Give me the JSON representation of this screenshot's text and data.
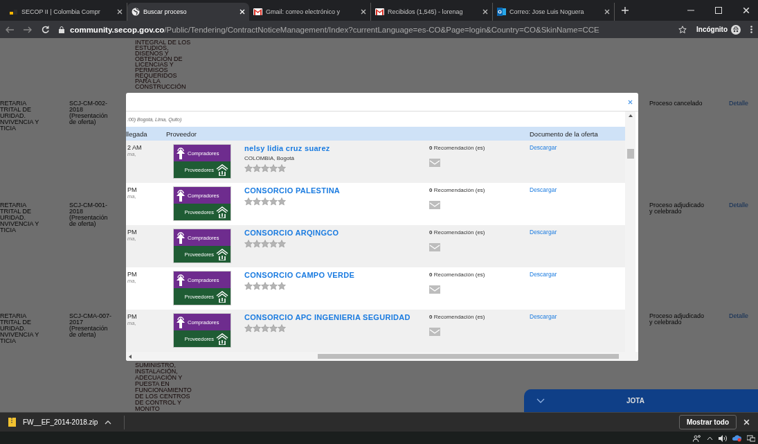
{
  "browser": {
    "tabs": [
      {
        "title": "SECOP II | Colombia Compr",
        "kind": "secop",
        "selected": false
      },
      {
        "title": "Buscar proceso",
        "kind": "globe",
        "selected": true
      },
      {
        "title": "Gmail: correo electrónico y",
        "kind": "gmail",
        "selected": false
      },
      {
        "title": "Recibidos (1,545) - lorenag",
        "kind": "gmail",
        "selected": false
      },
      {
        "title": "Correo: Jose Luis Noguera",
        "kind": "outlook",
        "selected": false
      }
    ],
    "address": {
      "host": "community.secop.gov.co",
      "path": "/Public/Tendering/ContractNoticeManagement/Index?currentLanguage=es-CO&Page=login&Country=CO&SkinName=CCE"
    },
    "incognito": "Incógnito"
  },
  "background_table": {
    "rows": [
      {
        "description": "INTEGRAL DE LOS\nESTUDIOS,\nDISEÑOS Y\nOBTENCIÓN DE\nLICENCIAS Y\nPERMISOS\nREQUERIDOS\nPARA LA\nCONSTRUCCIÓN"
      },
      {
        "entity": "RETARIA\nTRITAL DE\nURIDAD.\nNVIVENCIA Y\nTICIA",
        "code": "SCJ-CM-002-\n2018\n(Presentación\nde oferta)",
        "status": "Proceso cancelado",
        "link": "Detalle"
      },
      {
        "entity": "RETARIA\nTRITAL DE\nURIDAD.\nNVIVENCIA Y\nTICIA",
        "code": "SCJ-CM-001-\n2018\n(Presentación\nde oferta)",
        "status": "Proceso adjudicado\ny celebrado",
        "link": "Detalle"
      },
      {
        "entity": "RETARIA\nTRITAL DE\nURIDAD.\nNVIVENCIA Y\nTICIA",
        "code": "SCJ-CMA-007-\n2017\n(Presentación\nde oferta)",
        "description": "SUMINISTRO,\nINSTALACIÓN,\nADECUACIÓN Y\nPUESTA EN\nFUNCIONAMIENTO\nDE LOS CENTROS\nDE CONTROL Y\nMONITO",
        "status": "Proceso adjudicado\ny celebrado",
        "link": "Detalle"
      }
    ]
  },
  "modal": {
    "timezone": ":00) Bogotá, Lima, Quito)",
    "columns": [
      "llegada",
      "Proveedor",
      "Documento de la oferta"
    ],
    "rows": [
      {
        "time": "2 AM",
        "zone": "ma,",
        "logo_top": "Compradores",
        "logo_bottom": "Proveedores",
        "name": "nelsy lidia cruz suarez",
        "location": "COLOMBIA, Bogotá",
        "stars": 0,
        "recommendations": "**0** Recomendación (es)",
        "document": "Descargar"
      },
      {
        "time": "PM",
        "zone": "ma,",
        "logo_top": "Compradores",
        "logo_bottom": "Proveedores",
        "name": "CONSORCIO PALESTINA",
        "stars": 0,
        "recommendations": "**0** Recomendación (es)",
        "document": "Descargar"
      },
      {
        "time": "PM",
        "zone": "ma,",
        "logo_top": "Compradores",
        "logo_bottom": "Proveedores",
        "name": "CONSORCIO ARQINGCO",
        "stars": 0,
        "recommendations": "**0** Recomendación (es)",
        "document": "Descargar"
      },
      {
        "time": "PM",
        "zone": "ma,",
        "logo_top": "Compradores",
        "logo_bottom": "Proveedores",
        "name": "CONSORCIO CAMPO VERDE",
        "stars": 0,
        "recommendations": "**0** Recomendación (es)",
        "document": "Descargar"
      },
      {
        "time": "PM",
        "zone": "ma,",
        "logo_top": "Compradores",
        "logo_bottom": "Proveedores",
        "name": "CONSORCIO APC INGENIERIA SEGURIDAD",
        "stars": 0,
        "recommendations": "**0** Recomendación (es)",
        "document": "Descargar"
      }
    ]
  },
  "chat": {
    "name": "JOTA"
  },
  "download_bar": {
    "file": "FW__EF_2014-2018.zip",
    "show_all": "Mostrar todo"
  }
}
